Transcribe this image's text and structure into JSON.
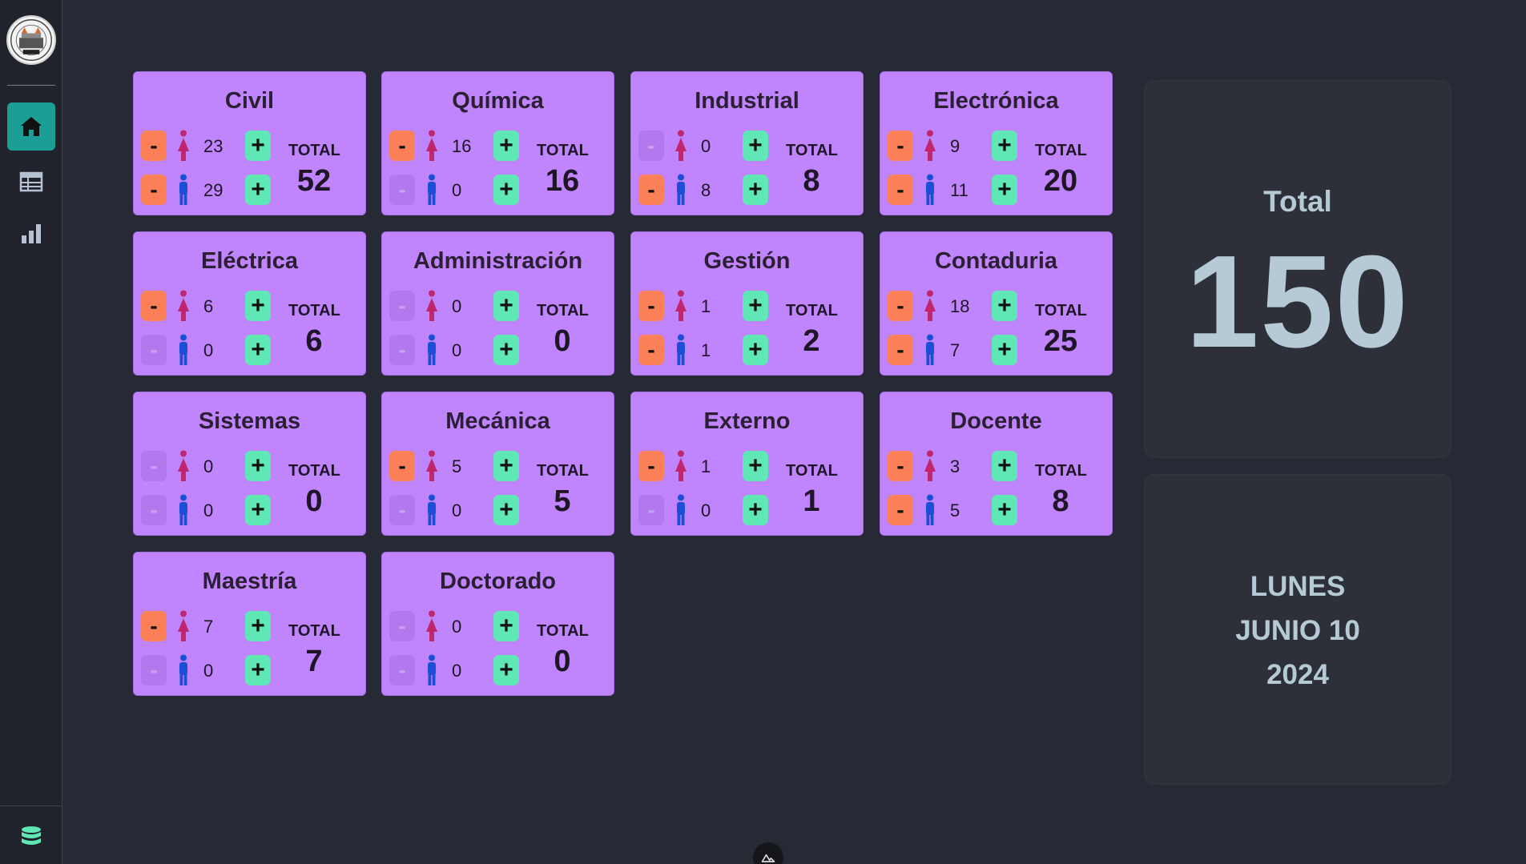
{
  "sidebar": {
    "nav": [
      {
        "id": "home",
        "icon": "home-icon",
        "active": true
      },
      {
        "id": "table",
        "icon": "table-icon",
        "active": false
      },
      {
        "id": "chart",
        "icon": "bar-chart-icon",
        "active": false
      }
    ],
    "bottom_icon": "database-icon"
  },
  "card_labels": {
    "total": "TOTAL"
  },
  "cards": [
    {
      "name": "Civil",
      "women": "23",
      "men": "29",
      "total": "52"
    },
    {
      "name": "Química",
      "women": "16",
      "men": "0",
      "total": "16"
    },
    {
      "name": "Industrial",
      "women": "0",
      "men": "8",
      "total": "8"
    },
    {
      "name": "Electrónica",
      "women": "9",
      "men": "11",
      "total": "20"
    },
    {
      "name": "Eléctrica",
      "women": "6",
      "men": "0",
      "total": "6"
    },
    {
      "name": "Administración",
      "women": "0",
      "men": "0",
      "total": "0"
    },
    {
      "name": "Gestión",
      "women": "1",
      "men": "1",
      "total": "2"
    },
    {
      "name": "Contaduria",
      "women": "18",
      "men": "7",
      "total": "25"
    },
    {
      "name": "Sistemas",
      "women": "0",
      "men": "0",
      "total": "0"
    },
    {
      "name": "Mecánica",
      "women": "5",
      "men": "0",
      "total": "5"
    },
    {
      "name": "Externo",
      "women": "1",
      "men": "0",
      "total": "1"
    },
    {
      "name": "Docente",
      "women": "3",
      "men": "5",
      "total": "8"
    },
    {
      "name": "Maestría",
      "women": "7",
      "men": "0",
      "total": "7"
    },
    {
      "name": "Doctorado",
      "women": "0",
      "men": "0",
      "total": "0"
    }
  ],
  "summary": {
    "title": "Total",
    "value": "150"
  },
  "date": {
    "weekday": "LUNES",
    "month_day": "JUNIO 10",
    "year": "2024"
  },
  "colors": {
    "card_bg": "#c084fc",
    "minus_active": "#fb8057",
    "plus": "#5fe8b6",
    "female_icon": "#c0266b",
    "male_icon": "#1d4fd6",
    "accent_nav": "#1a9e96"
  }
}
